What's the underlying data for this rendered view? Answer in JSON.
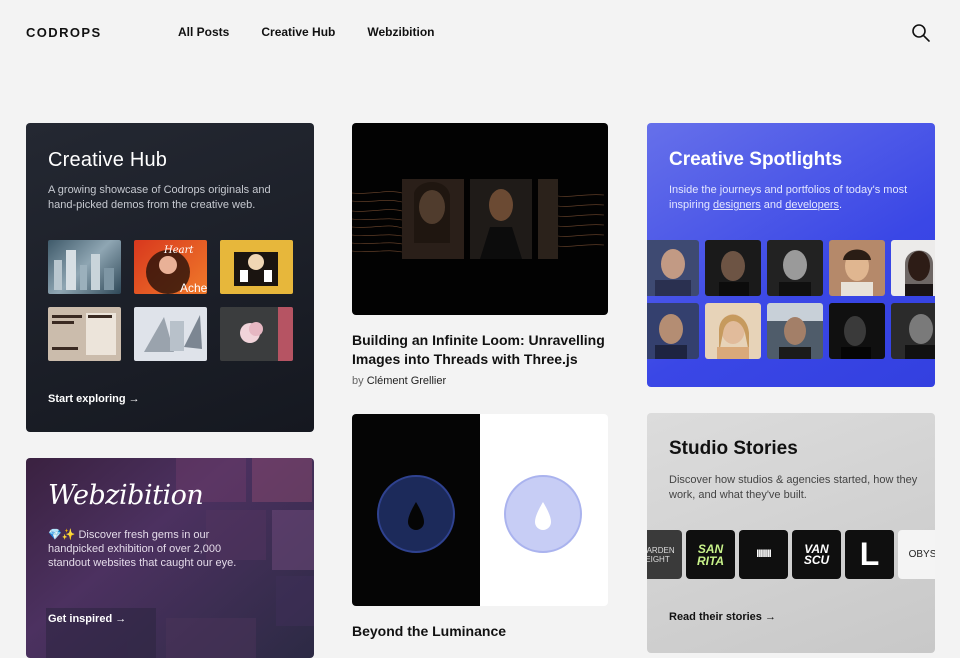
{
  "header": {
    "logo": "CODROPS",
    "nav": [
      "All Posts",
      "Creative Hub",
      "Webzibition"
    ]
  },
  "hub": {
    "title": "Creative Hub",
    "description": "A growing showcase of Codrops originals and hand-picked demos from the creative web.",
    "cta": "Start exploring →",
    "thumb_texts": {
      "heart": "Heart",
      "ache": "Ache"
    }
  },
  "webzibition": {
    "title": "Webzibition",
    "description": "💎✨ Discover fresh gems in our handpicked exhibition of over 2,000 standout websites that caught our eye.",
    "cta": "Get inspired →"
  },
  "article1": {
    "title": "Building an Infinite Loom: Unravelling Images into Threads with Three.js",
    "by": "by",
    "author": "Clément Grellier"
  },
  "article2": {
    "title": "Beyond the Luminance"
  },
  "spotlights": {
    "title": "Creative Spotlights",
    "desc_before": "Inside the journeys and portfolios of today's most inspiring ",
    "link1": "designers",
    "and": " and ",
    "link2": "developers",
    "desc_after": "."
  },
  "studio": {
    "title": "Studio Stories",
    "description": "Discover how studios & agencies started, how they work, and what they've built.",
    "cta": "Read their stories →",
    "logos": [
      "GARDEN EIGHT",
      "SAN RITA",
      "IIIIIII",
      "VAN SCU",
      "L",
      "OBYS"
    ]
  }
}
